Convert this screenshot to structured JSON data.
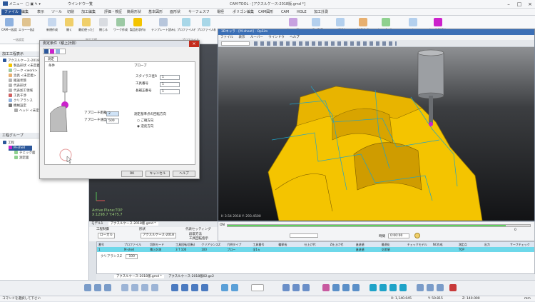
{
  "title_bar": {
    "title": "CAM-TOOL - [アクスルケース-2018版.gmd *]",
    "quick_menu": "メニュー",
    "window_menu": "ウインドウ一覧"
  },
  "menu": [
    "ファイル",
    "編集",
    "表示",
    "ツール",
    "切削",
    "加工編集",
    "評価・検証",
    "簡易形状",
    "基本図形",
    "面形状",
    "サーフェスフ",
    "電極",
    "ポリゴン編集",
    "CAM図形",
    "CAM",
    "HOLE",
    "加工計測"
  ],
  "ribbon": {
    "buttons": [
      "CAM一括設定",
      "エラー一括設定",
      "新規作成",
      "開く",
      "最近使った工程",
      "閉じる",
      "ワーク作成",
      "製品形状作成",
      "テンプレート読み込み",
      "プロファイル作成",
      "プロファイル編集",
      "加工工程",
      "工程一覧表",
      "工程設定",
      "治具作成",
      "加工パス作成",
      "マクロ",
      "加工計測設定"
    ],
    "groups": [
      "一括設定",
      "加工工程",
      "プロファイル"
    ]
  },
  "left_panel": {
    "header1": "加工工程表示",
    "tree": [
      "アクスルケース-2018版",
      "製品形状 <未定義>",
      "ワーク <work>",
      "治具 <未定義>",
      "搬送状態",
      "代表形状",
      "代表加工領域",
      "工具干渉",
      "クリアランス",
      "機械設定",
      "ヘッド <未定義>"
    ],
    "header2": "工程グループ",
    "tree2": [
      "工程",
      "M-shell",
      "チェック面",
      "測定面"
    ]
  },
  "viewport": {
    "active_plane": "Active Plane:TOP",
    "coords": "X:1298.7 Y:475.7"
  },
  "dialog": {
    "title": "測定条件（積上計測）",
    "tab": "測定",
    "section_cond": "条件",
    "section_probe": "プローブ",
    "probe_fields": [
      {
        "label": "スタイラス径R",
        "value": "1"
      },
      {
        "label": "工具番号",
        "value": "1"
      },
      {
        "label": "長補正番号",
        "value": "1"
      }
    ],
    "approach_dist_label": "アプローチ距離",
    "approach_dist_value": "2",
    "approach_speed_label": "アプローチ速度",
    "approach_speed_value": "500",
    "direction_title": "測定基準点の回転方向",
    "options": [
      "ご確方向",
      "逆反方向"
    ],
    "ok": "OK",
    "cancel": "キャンセル",
    "help": "ヘルプ"
  },
  "subwindow": {
    "title": "3Dキャラ - [M-sheet] - OpSim",
    "menu": [
      "ファイル",
      "表示",
      "ルーバー",
      "ウインドウ",
      "ヘルプ"
    ],
    "status": "H 3.54 2018 Y: 293.4500"
  },
  "progress": {
    "label": "ON",
    "fill_fraction": 0.92,
    "value": "0",
    "time_label": "時間",
    "time": "0:00:00"
  },
  "bottom_tabs": [
    "モデル1",
    "アクスルケース-2018版.gmd *"
  ],
  "op_panel": {
    "group_label": "工程制御",
    "category": "形状",
    "category_value": "アクスルケース-2018",
    "global_select": "ローカル",
    "settings": "代表セッティング",
    "mode": "段取方法",
    "return": "工具回転指示",
    "clearance": "クリアランスZ",
    "clearance_value": "100"
  },
  "table": {
    "headers": [
      "番号",
      "プロファイル",
      "切削モード",
      "工具回転(回転)",
      "クリアランスZ",
      "穴明タイプ",
      "工具番号",
      "輪郭長",
      "仕上げ代",
      "Z仕上げ代",
      "進退値",
      "最適化",
      "チェックモデル",
      "NC作成",
      "測定点",
      "出力",
      "サーフチェック"
    ],
    "rows": [
      [
        "1",
        "M-shell",
        "積上計測",
        "3 T 100",
        "100",
        "ブロー",
        "全1ヵ",
        "",
        "",
        "",
        "進退値",
        "交差値",
        "",
        "",
        "TOP",
        "",
        "",
        "付加あり"
      ]
    ]
  },
  "tab_strip": [
    "アクスルケース-2018版.gmd *",
    "アクスルケース-2018版02.gc2"
  ],
  "status_bar": {
    "message": "コマンドを選択して下さい",
    "x_label": "X:",
    "x": "1,140.045",
    "y_label": "Y:",
    "y": "50.815",
    "z_label": "Z:",
    "z": "140.000",
    "unit": "mm"
  },
  "colors": {
    "accent": "#2b579a",
    "part_yellow": "#f4c400",
    "table_highlight": "#6ed8ea",
    "probe_magenta": "#cc22cc",
    "progress_green": "#5fd35f"
  }
}
